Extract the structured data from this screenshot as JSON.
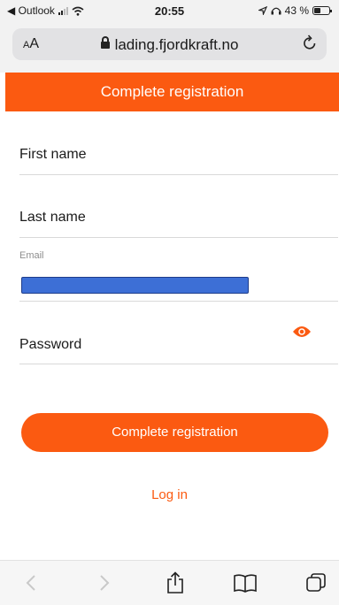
{
  "status_bar": {
    "back_app": "◀ Outlook",
    "time": "20:55",
    "battery_text": "43 %"
  },
  "address_bar": {
    "text_size_label_small": "A",
    "text_size_label_large": "A",
    "domain": "lading.fjordkraft.no"
  },
  "header": {
    "title": "Complete registration"
  },
  "form": {
    "first_name_label": "First name",
    "last_name_label": "Last name",
    "email_label": "Email",
    "password_label": "Password"
  },
  "actions": {
    "submit_label": "Complete registration",
    "login_label": "Log in"
  },
  "colors": {
    "accent": "#fb5a11",
    "redaction": "#3d6fd6"
  },
  "toolbar_icons": [
    "back-icon",
    "forward-icon",
    "share-icon",
    "bookmarks-icon",
    "tabs-icon"
  ]
}
